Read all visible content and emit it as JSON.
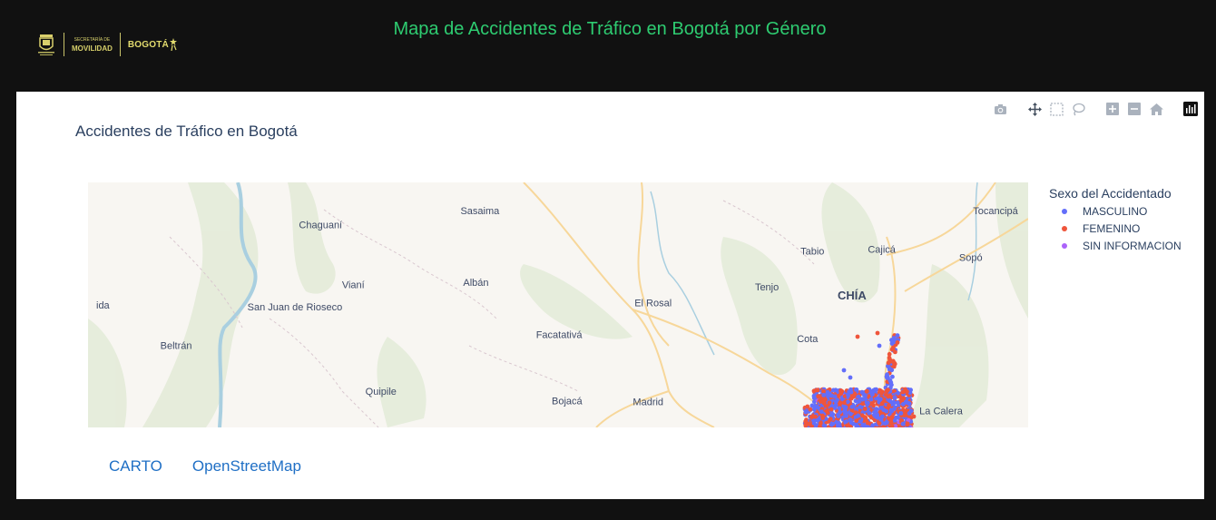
{
  "header": {
    "title": "Mapa de Accidentes de Tráfico en Bogotá por Género",
    "logo_mov_sup": "SECRETARÍA DE",
    "logo_mov": "MOVILIDAD",
    "logo_bogota": "BOGOTÁ"
  },
  "chart": {
    "title": "Accidentes de Tráfico en Bogotá",
    "legend": {
      "title": "Sexo del Accidentado",
      "items": [
        {
          "label": "MASCULINO",
          "color": "#636efa"
        },
        {
          "label": "FEMENINO",
          "color": "#ef553b"
        },
        {
          "label": "SIN INFORMACION",
          "color": "#ab63fa"
        }
      ]
    },
    "modebar": [
      "camera-icon",
      "pan-icon",
      "box-select-icon",
      "lasso-select-icon",
      "zoom-in-icon",
      "zoom-out-icon",
      "reset-view-icon",
      "plotly-logo-icon"
    ]
  },
  "map": {
    "places": [
      {
        "name": "Chaguaní",
        "lon": -74.595,
        "lat": 4.948
      },
      {
        "name": "Sasaima",
        "lon": -74.434,
        "lat": 4.965
      },
      {
        "name": "Tocancipá",
        "lon": -73.913,
        "lat": 4.965
      },
      {
        "name": "Tabio",
        "lon": -74.098,
        "lat": 4.916
      },
      {
        "name": "Cajicá",
        "lon": -74.028,
        "lat": 4.918
      },
      {
        "name": "Sopó",
        "lon": -73.938,
        "lat": 4.908
      },
      {
        "name": "ida",
        "lon": -74.815,
        "lat": 4.85
      },
      {
        "name": "Vianí",
        "lon": -74.562,
        "lat": 4.875
      },
      {
        "name": "Albán",
        "lon": -74.438,
        "lat": 4.878
      },
      {
        "name": "Tenjo",
        "lon": -74.144,
        "lat": 4.872
      },
      {
        "name": "CHÍA",
        "lon": -74.058,
        "lat": 4.861
      },
      {
        "name": "El Rosal",
        "lon": -74.259,
        "lat": 4.853
      },
      {
        "name": "San Juan de Rioseco",
        "lon": -74.621,
        "lat": 4.848
      },
      {
        "name": "Facatativá",
        "lon": -74.354,
        "lat": 4.814
      },
      {
        "name": "Cota",
        "lon": -74.103,
        "lat": 4.809
      },
      {
        "name": "Beltrán",
        "lon": -74.741,
        "lat": 4.801
      },
      {
        "name": "Quipile",
        "lon": -74.534,
        "lat": 4.745
      },
      {
        "name": "Bojacá",
        "lon": -74.346,
        "lat": 4.733
      },
      {
        "name": "Madrid",
        "lon": -74.264,
        "lat": 4.732
      },
      {
        "name": "La Calera",
        "lon": -73.968,
        "lat": 4.721
      }
    ],
    "view": {
      "lon_min": -74.83,
      "lon_max": -73.88,
      "lat_min": 4.705,
      "lat_max": 5.004
    },
    "basemaps": [
      "CARTO",
      "OpenStreetMap"
    ]
  }
}
